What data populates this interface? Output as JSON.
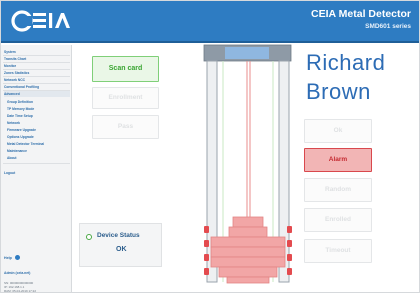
{
  "header": {
    "logo_text": "CEIA",
    "title": "CEIA Metal Detector",
    "subtitle": "SMD601 series",
    "background": "#2e7cc2"
  },
  "sidebar": {
    "items": [
      {
        "label": "System",
        "sub": false,
        "active": false
      },
      {
        "label": "Transits Chart",
        "sub": false,
        "active": false
      },
      {
        "label": "Monitor",
        "sub": false,
        "active": false
      },
      {
        "label": "Zones Statistics",
        "sub": false,
        "active": false
      },
      {
        "label": "Network NCC",
        "sub": false,
        "active": false
      },
      {
        "label": "Conventional Profiling",
        "sub": false,
        "active": false
      },
      {
        "label": "Advanced",
        "sub": false,
        "active": true
      },
      {
        "label": "Group Definition",
        "sub": true,
        "active": false
      },
      {
        "label": "TP Memory Mode",
        "sub": true,
        "active": false
      },
      {
        "label": "Date Time Setup",
        "sub": true,
        "active": false
      },
      {
        "label": "Network",
        "sub": true,
        "active": false
      },
      {
        "label": "Firmware Upgrade",
        "sub": true,
        "active": false
      },
      {
        "label": "Options Upgrade",
        "sub": true,
        "active": false
      },
      {
        "label": "Metal Detector Terminal",
        "sub": true,
        "active": false
      },
      {
        "label": "Maintenance",
        "sub": true,
        "active": false
      },
      {
        "label": "About",
        "sub": true,
        "active": false
      },
      {
        "label": "Logout",
        "sub": false,
        "active": false
      }
    ],
    "help_label": "Help",
    "user_label": "Admin (ceia.net)",
    "meta_lines": [
      "SN: 00000000000000",
      "IP: 192.168.1.1",
      "RAM: 05-04-2019 17:22"
    ]
  },
  "main": {
    "scan_card": "Scan card",
    "enrollment": "Enrollment",
    "pass": "Pass",
    "first_name": "Richard",
    "last_name": "Brown",
    "ok": "Ok",
    "alarm": "Alarm",
    "random": "Random",
    "enrolled": "Enrolled",
    "timeout": "Timeout",
    "device_status_label": "Device Status",
    "device_status_value": "OK"
  },
  "colors": {
    "accent_blue": "#2e7cc2",
    "name_blue": "#2d6cb5",
    "ok_green": "#3aa532",
    "alarm_red": "#d9484d",
    "zone_pink": "#f2a6a6"
  },
  "icons": {
    "logo": "ceia-logo-icon",
    "help": "help-icon",
    "status": "status-indicator-icon"
  }
}
